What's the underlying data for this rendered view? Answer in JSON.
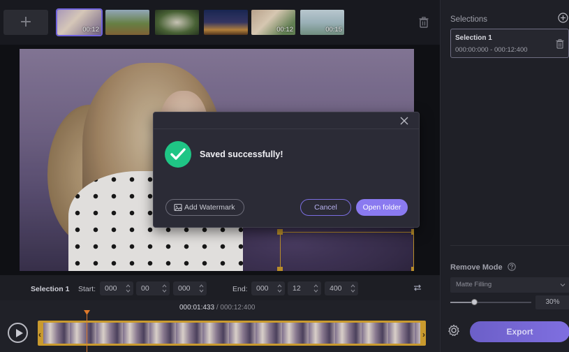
{
  "thumbnails": [
    {
      "duration": "00:12",
      "active": true
    },
    {
      "duration": ""
    },
    {
      "duration": ""
    },
    {
      "duration": ""
    },
    {
      "duration": "00:12"
    },
    {
      "duration": "00:15"
    }
  ],
  "add_button_glyph": "+",
  "selection_row": {
    "name": "Selection 1",
    "start_label": "Start:",
    "start": [
      "000",
      "00",
      "000"
    ],
    "end_label": "End:",
    "end": [
      "000",
      "12",
      "400"
    ]
  },
  "timecode": {
    "current": "000:01:433",
    "separator": " / ",
    "total": "000:12:400"
  },
  "right_panel": {
    "selections_title": "Selections",
    "card_title": "Selection 1",
    "card_range": "000:00:000 - 000:12:400",
    "remove_mode_title": "Remove Mode",
    "mode_value": "Matte Filling",
    "percent_value": 30,
    "percent_label": "30%",
    "export_label": "Export"
  },
  "dialog": {
    "message": "Saved successfully!",
    "watermark_label": "Add Watermark",
    "cancel_label": "Cancel",
    "open_label": "Open folder"
  },
  "colors": {
    "accent": "#8a7af0",
    "success": "#1fc585",
    "selection": "#c99a2e"
  },
  "icons": [
    "trash-icon",
    "close-icon",
    "check-icon",
    "plus-circle-icon",
    "help-icon",
    "chevron-down-icon",
    "gear-icon",
    "watermark-icon",
    "loop-icon",
    "play-icon"
  ]
}
